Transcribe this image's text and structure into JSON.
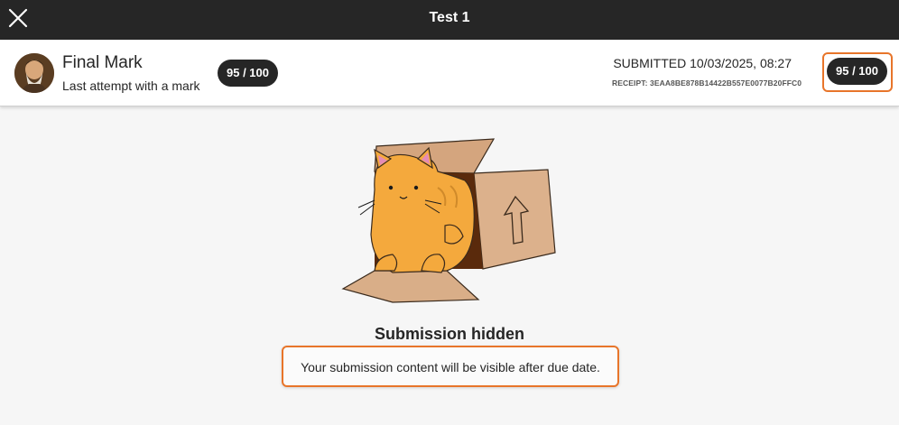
{
  "topbar": {
    "title": "Test 1",
    "close_icon": "close-icon"
  },
  "mark": {
    "title": "Final Mark",
    "subtitle": "Last attempt with a mark",
    "score": "95 / 100",
    "avatar_icon": "avatar"
  },
  "submission": {
    "submitted": "SUBMITTED 10/03/2025, 08:27",
    "receipt": "RECEIPT: 3EAA8BE878B14422B557E0077B20FFC0",
    "score": "95 / 100"
  },
  "content": {
    "illustration_icon": "cat-in-box-illustration",
    "hidden_title": "Submission hidden",
    "message": "Your submission content will be visible after due date."
  },
  "colors": {
    "topbar": "#262626",
    "focus_outline": "#e8752a",
    "pill": "#262626",
    "cat": "#f4a93d",
    "box": "#d9ae88"
  }
}
